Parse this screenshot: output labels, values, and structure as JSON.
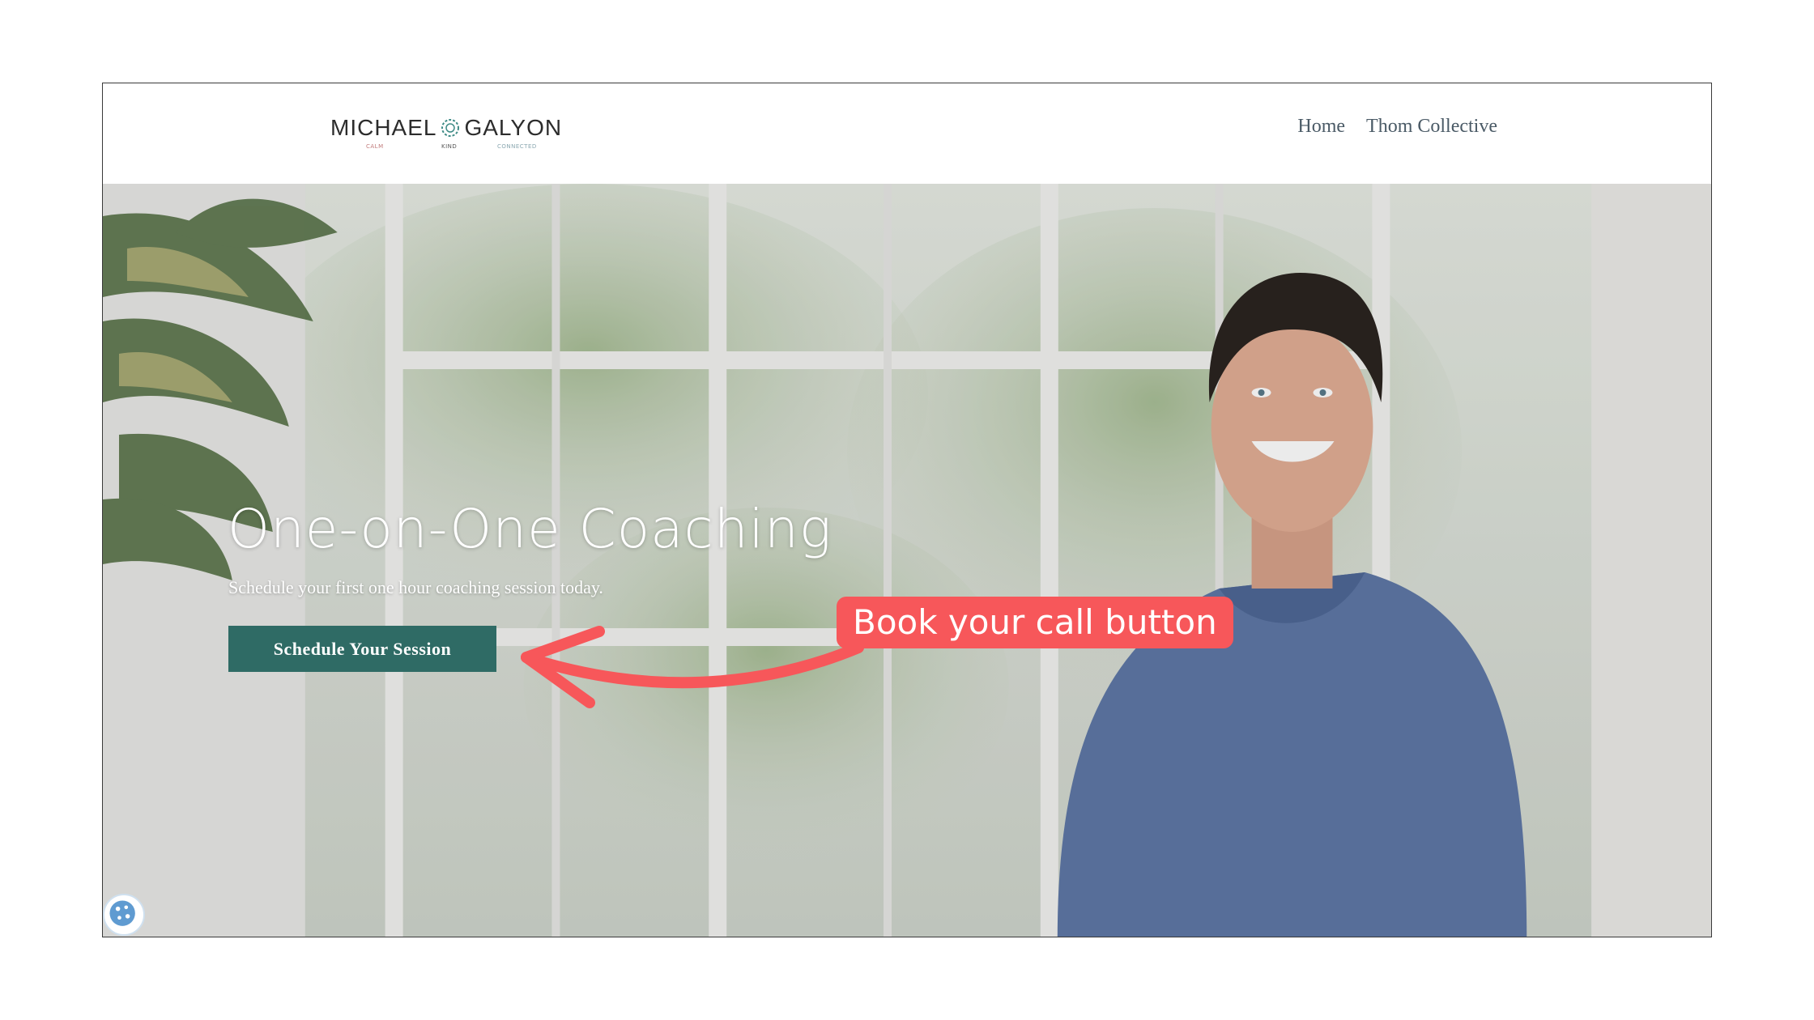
{
  "header": {
    "logo": {
      "first": "MICHAEL",
      "last": "GALYON",
      "tags": [
        "CALM",
        "KIND",
        "CONNECTED"
      ]
    },
    "nav": [
      "Home",
      "Thom Collective"
    ]
  },
  "hero": {
    "title": "One-on-One Coaching",
    "subtitle": "Schedule your first one hour coaching session today.",
    "cta_label": "Schedule Your Session"
  },
  "annotation": {
    "label": "Book your call button",
    "color": "#f7575a"
  },
  "colors": {
    "cta": "#2f6b65",
    "nav_text": "#4a5a66",
    "frame_border": "#3a3a3a"
  },
  "icons": {
    "logo_mark": "teal-rosette-icon",
    "cookie": "cookie-icon",
    "arrow": "curved-arrow-left-icon"
  }
}
